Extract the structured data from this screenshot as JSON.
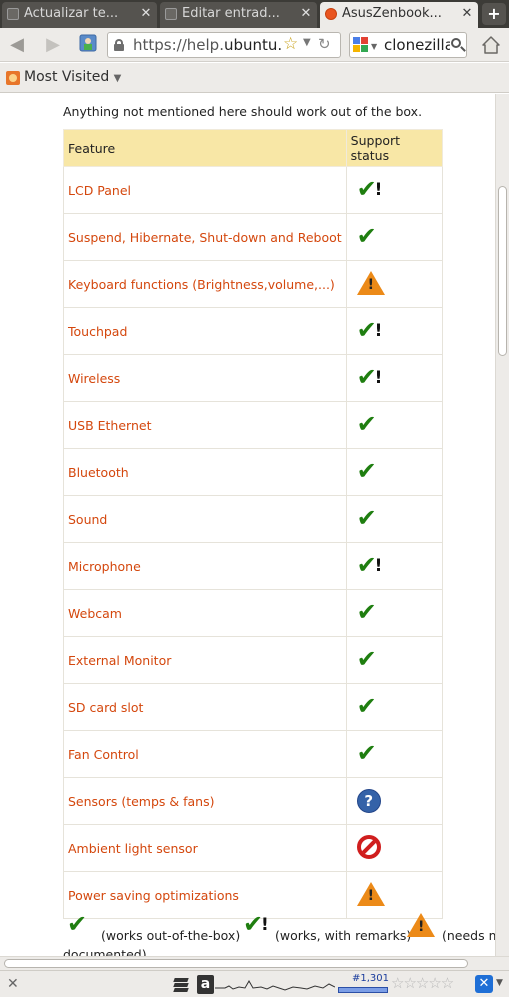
{
  "browser": {
    "tabs": [
      {
        "label": "Actualizar te..."
      },
      {
        "label": "Editar entrad..."
      },
      {
        "label": "AsusZenbook..."
      }
    ],
    "new_tab_label": "+",
    "url_prefix": "https://help.",
    "url_host": "ubuntu.co",
    "search_value": "clonezilla",
    "bookmarks_label": "Most Visited"
  },
  "page": {
    "intro": "Anything not mentioned here should work out of the box.",
    "table_headers": {
      "feature": "Feature",
      "status": "Support status"
    },
    "rows": [
      {
        "feature": "LCD Panel",
        "status": "works-remarks"
      },
      {
        "feature": "Suspend, Hibernate, Shut-down and Reboot",
        "status": "works"
      },
      {
        "feature": "Keyboard functions (Brightness,volume,...)",
        "status": "needs-work"
      },
      {
        "feature": "Touchpad",
        "status": "works-remarks"
      },
      {
        "feature": "Wireless",
        "status": "works-remarks"
      },
      {
        "feature": "USB Ethernet",
        "status": "works"
      },
      {
        "feature": "Bluetooth",
        "status": "works"
      },
      {
        "feature": "Sound",
        "status": "works"
      },
      {
        "feature": "Microphone",
        "status": "works-remarks"
      },
      {
        "feature": "Webcam",
        "status": "works"
      },
      {
        "feature": "External Monitor",
        "status": "works"
      },
      {
        "feature": "SD card slot",
        "status": "works"
      },
      {
        "feature": "Fan Control",
        "status": "works"
      },
      {
        "feature": "Sensors (temps & fans)",
        "status": "unknown"
      },
      {
        "feature": "Ambient light sensor",
        "status": "not-working"
      },
      {
        "feature": "Power saving optimizations",
        "status": "needs-work"
      }
    ],
    "legend": {
      "works": "(works out-of-the-box)",
      "works_remarks": "(works, with remarks)",
      "needs_work": "(needs m",
      "continuation": "documented)"
    }
  },
  "statusbar": {
    "rank": "#1,301"
  },
  "colors": {
    "link": "#d4470d",
    "header_bg": "#f8e7a6",
    "check": "#1f7e10",
    "warning": "#ec8a18"
  }
}
